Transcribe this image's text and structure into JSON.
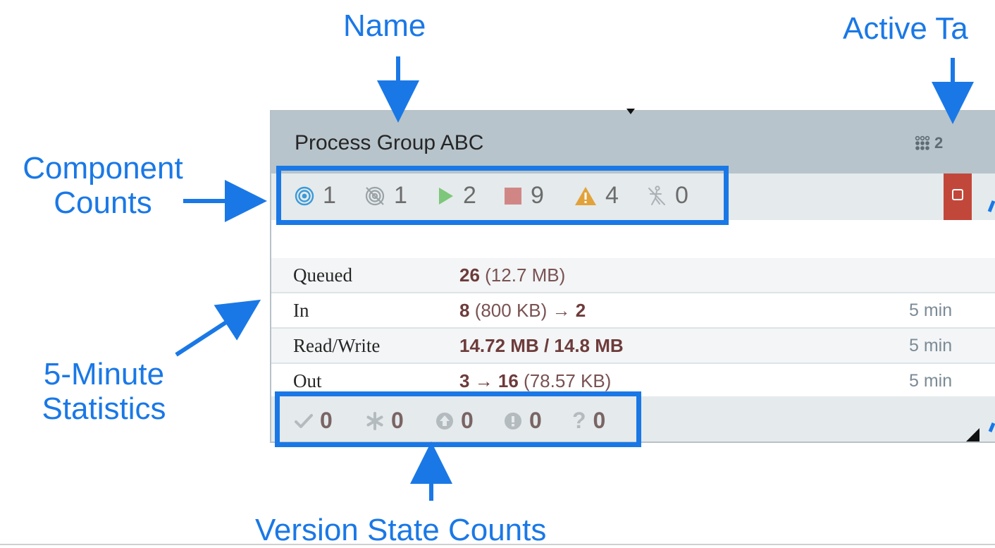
{
  "callouts": {
    "name": "Name",
    "active_tasks": "Active Ta",
    "component_counts_line1": "Component",
    "component_counts_line2": "Counts",
    "stats_line1": "5-Minute",
    "stats_line2": "Statistics",
    "version_state_counts": "Version State Counts"
  },
  "process_group": {
    "name": "Process Group ABC",
    "active_task_count": "2",
    "component_counts": {
      "transmitting": "1",
      "not_transmitting": "1",
      "running": "2",
      "stopped": "9",
      "invalid": "4",
      "disabled": "0"
    },
    "stats": [
      {
        "label": "Queued",
        "value_bold": "26",
        "value_rest": " (12.7 MB)",
        "time": ""
      },
      {
        "label": "In",
        "value_bold": "8",
        "value_rest": " (800 KB) → ",
        "value_bold2": "2",
        "time": "5 min"
      },
      {
        "label": "Read/Write",
        "value_bold": "14.72 MB / 14.8 MB",
        "value_rest": "",
        "time": "5 min"
      },
      {
        "label": "Out",
        "value_bold": "3 → 16",
        "value_rest": " (78.57 KB)",
        "time": "5 min"
      }
    ],
    "version_state_counts": {
      "up_to_date": "0",
      "locally_modified": "0",
      "stale": "0",
      "locally_modified_and_stale": "0",
      "sync_failure": "0"
    },
    "sync_failure_symbol": "?"
  },
  "colors": {
    "callout_blue": "#1a78e6",
    "header_gray": "#b7c4cb",
    "bulletin_red": "#c2473b",
    "running_green": "#7dc77a",
    "stopped_red": "#d18686",
    "invalid_orange": "#e2a23a"
  }
}
